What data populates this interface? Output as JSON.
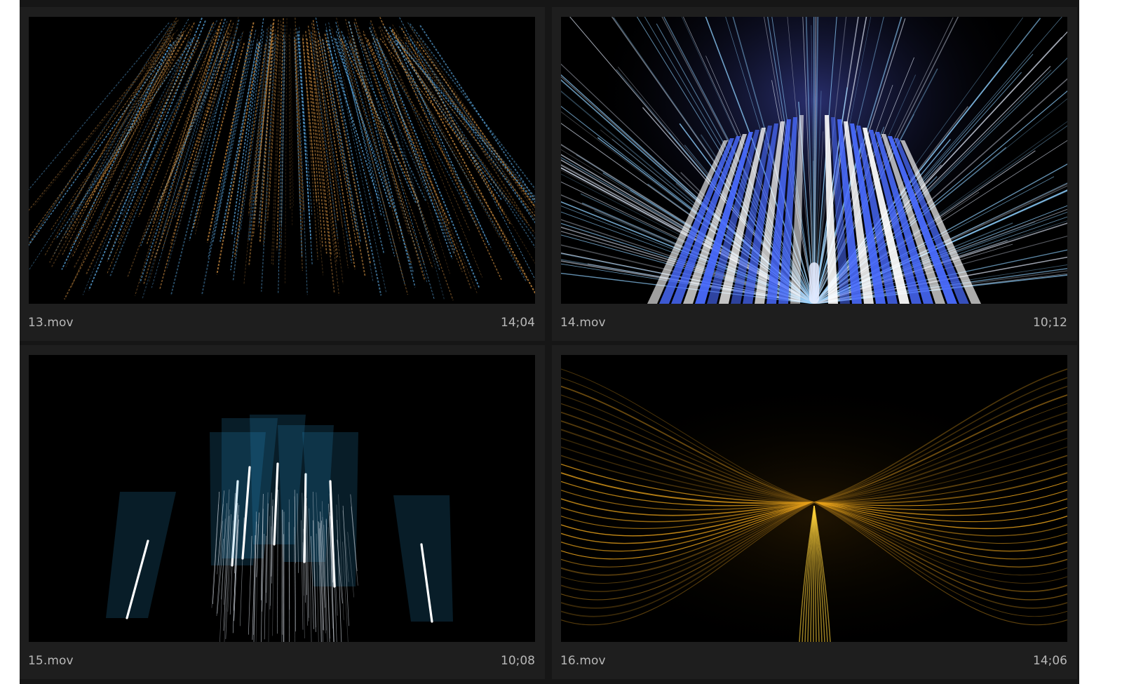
{
  "clips": [
    {
      "name": "13.mov",
      "duration": "14;04",
      "palette": [
        "#c98a3e",
        "#5aa7e0"
      ],
      "style": "rain-streaks"
    },
    {
      "name": "14.mov",
      "duration": "10;12",
      "palette": [
        "#4a6cff",
        "#8fd0ff",
        "#ffffff"
      ],
      "style": "light-tunnel"
    },
    {
      "name": "15.mov",
      "duration": "10;08",
      "palette": [
        "#2a9fe0",
        "#ffffff"
      ],
      "style": "light-bars"
    },
    {
      "name": "16.mov",
      "duration": "14;06",
      "palette": [
        "#e8a21a",
        "#ffd23a"
      ],
      "style": "golden-flow"
    }
  ]
}
